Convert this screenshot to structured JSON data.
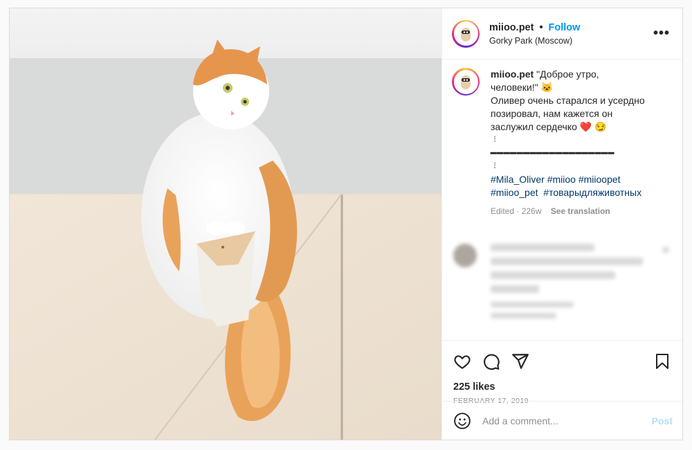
{
  "post": {
    "username": "miioo.pet",
    "follow_label": "Follow",
    "location": "Gorky Park (Moscow)",
    "more_label": "•••"
  },
  "caption": {
    "username": "miioo.pet",
    "line1": "\"Доброе утро,",
    "line2": "человеки!\" 🐱",
    "line3": "Оливер очень старался и усердно",
    "line4": "позировал, нам кажется он",
    "line5": "заслужил сердечко ❤️ 😏",
    "dots1": "⠸",
    "separator": "━━━━━━━━━━━━━━━━━━━",
    "dots2": "⠸",
    "tags": [
      "#Mila_Oliver",
      "#miioo",
      "#miioopet",
      "#miioo_pet",
      "#товарыдляживотных"
    ],
    "edited": "Edited",
    "age": "226w",
    "see_translation": "See translation"
  },
  "stats": {
    "likes": "225 likes",
    "date": "FEBRUARY 17, 2019"
  },
  "comment_input": {
    "placeholder": "Add a comment...",
    "post_label": "Post"
  },
  "icons": {
    "like": "heart-icon",
    "comment": "comment-icon",
    "share": "share-icon",
    "save": "bookmark-icon",
    "emoji": "emoji-icon",
    "more": "more-icon"
  },
  "colors": {
    "accent": "#0095f6",
    "link": "#00376b",
    "muted": "#8e8e8e",
    "post_disabled": "#b2dffc"
  }
}
